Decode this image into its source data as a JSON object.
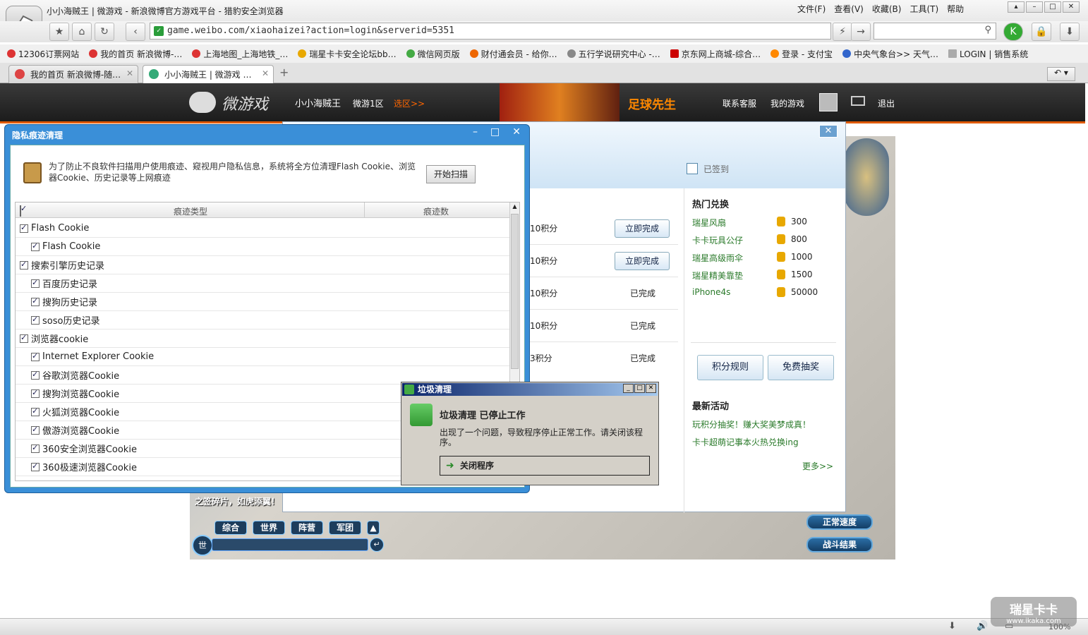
{
  "browser": {
    "window_title": "小小海贼王 | 微游戏 - 新浪微博官方游戏平台 - 猎豹安全浏览器",
    "menu": [
      "文件(F)",
      "查看(V)",
      "收藏(B)",
      "工具(T)",
      "帮助"
    ],
    "url": "game.weibo.com/xiaohaizei?action=login&serverid=5351",
    "bookmarks": [
      "12306订票网站",
      "我的首页 新浪微博-…",
      "上海地图_上海地铁_…",
      "瑞星卡卡安全论坛bb…",
      "微信网页版",
      "财付通会员 - 给你…",
      "五行学说研究中心 -…",
      "京东网上商城-综合…",
      "登录 - 支付宝",
      "中央气象台>> 天气…",
      "LOGIN | 销售系统"
    ],
    "tabs": [
      "我的首页 新浪微博-随…",
      "小小海贼王 | 微游戏 …"
    ],
    "zoom": "100%"
  },
  "game_header": {
    "brand": "微游戏",
    "game_name": "小小海贼王",
    "server": "微游1区",
    "select_server": "选区>>",
    "ad_title": "足球先生",
    "links": [
      "联系客服",
      "我的游戏",
      "退出"
    ]
  },
  "points_panel": {
    "signed": "已签到",
    "tasks": [
      {
        "points": "10积分",
        "action": "立即完成",
        "done": false
      },
      {
        "points": "10积分",
        "action": "立即完成",
        "done": false
      },
      {
        "points": "10积分",
        "action": "已完成",
        "done": true
      },
      {
        "points": "10积分",
        "action": "已完成",
        "done": true
      },
      {
        "points": "3积分",
        "action": "已完成",
        "done": true
      }
    ],
    "hot_title": "热门兑换",
    "hot_items": [
      {
        "name": "瑞星风扇",
        "cost": "300"
      },
      {
        "name": "卡卡玩具公仔",
        "cost": "800"
      },
      {
        "name": "瑞星高级雨伞",
        "cost": "1000"
      },
      {
        "name": "瑞星精美靠垫",
        "cost": "1500"
      },
      {
        "name": "iPhone4s",
        "cost": "50000"
      }
    ],
    "rules_btn": "积分规则",
    "lottery_btn": "免费抽奖",
    "news_title": "最新活动",
    "news": [
      "玩积分抽奖！赚大奖美梦成真！",
      "卡卡超萌记事本火热兑换ing"
    ],
    "more": "更多>>"
  },
  "game_ui": {
    "chat_tabs": [
      "综合",
      "世界",
      "阵营",
      "军团"
    ],
    "chat_channel": "世",
    "ticker": "之签碎片，如虎添翼！",
    "speed_btn": "正常速度",
    "result_btn": "战斗结果"
  },
  "privacy_window": {
    "title": "隐私痕迹清理",
    "description": "为了防止不良软件扫描用户使用痕迹、窥视用户隐私信息，系统将全方位清理Flash Cookie、浏览器Cookie、历史记录等上网痕迹",
    "scan_btn": "开始扫描",
    "col_type": "痕迹类型",
    "col_count": "痕迹数",
    "rows": [
      {
        "label": "Flash Cookie",
        "level": 0
      },
      {
        "label": "Flash Cookie",
        "level": 1
      },
      {
        "label": "搜索引擎历史记录",
        "level": 0
      },
      {
        "label": "百度历史记录",
        "level": 1
      },
      {
        "label": "搜狗历史记录",
        "level": 1
      },
      {
        "label": "soso历史记录",
        "level": 1
      },
      {
        "label": "浏览器cookie",
        "level": 0
      },
      {
        "label": "Internet Explorer Cookie",
        "level": 1
      },
      {
        "label": "谷歌浏览器Cookie",
        "level": 1
      },
      {
        "label": "搜狗浏览器Cookie",
        "level": 1
      },
      {
        "label": "火狐浏览器Cookie",
        "level": 1
      },
      {
        "label": "傲游浏览器Cookie",
        "level": 1
      },
      {
        "label": "360安全浏览器Cookie",
        "level": 1
      },
      {
        "label": "360极速浏览器Cookie",
        "level": 1
      }
    ]
  },
  "error_dialog": {
    "title": "垃圾清理",
    "heading": "垃圾清理 已停止工作",
    "message": "出现了一个问题，导致程序停止正常工作。请关闭该程序。",
    "close_btn": "关闭程序"
  },
  "watermark": {
    "brand": "瑞星卡卡",
    "site": "www.ikaka.com"
  }
}
